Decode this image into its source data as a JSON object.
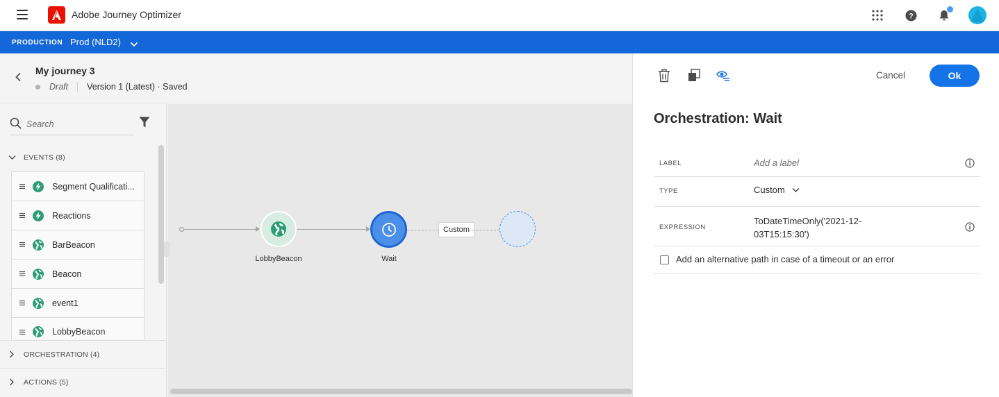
{
  "app": {
    "title": "Adobe Journey Optimizer"
  },
  "sandbox": {
    "label": "PRODUCTION",
    "name": "Prod (NLD2)"
  },
  "journey": {
    "title": "My journey 3",
    "status": "Draft",
    "version": "Version 1 (Latest) · Saved"
  },
  "palette": {
    "search_placeholder": "Search",
    "events_label": "EVENTS (8)",
    "events": [
      {
        "label": "Segment Qualificati...",
        "icon": "lightning-icon"
      },
      {
        "label": "Reactions",
        "icon": "lightning-icon"
      },
      {
        "label": "BarBeacon",
        "icon": "globe-icon"
      },
      {
        "label": "Beacon",
        "icon": "globe-icon"
      },
      {
        "label": "event1",
        "icon": "globe-icon"
      },
      {
        "label": "LobbyBeacon",
        "icon": "globe-icon"
      }
    ],
    "orchestration_label": "ORCHESTRATION (4)",
    "actions_label": "ACTIONS (5)"
  },
  "canvas": {
    "nodes": [
      {
        "label": "LobbyBeacon",
        "icon": "globe-icon"
      },
      {
        "label": "Wait",
        "icon": "clock-icon"
      }
    ],
    "path_label": "Custom"
  },
  "panel": {
    "cancel_label": "Cancel",
    "ok_label": "Ok",
    "title": "Orchestration: Wait",
    "label_field": {
      "label": "LABEL",
      "placeholder": "Add a label",
      "value": ""
    },
    "type_field": {
      "label": "TYPE",
      "value": "Custom"
    },
    "expression_field": {
      "label": "EXPRESSION",
      "line1": "ToDateTimeOnly('2021-12-",
      "line2": "03T15:15:30')"
    },
    "alt_path": {
      "label": "Add an alternative path in case of a timeout or an error",
      "checked": false
    }
  },
  "colors": {
    "sandbox_bar": "#1467d8",
    "primary_button": "#1473e6",
    "adobe_red": "#eb1000",
    "event_green": "#2d9d78",
    "wait_node": "#4b8fe8"
  }
}
